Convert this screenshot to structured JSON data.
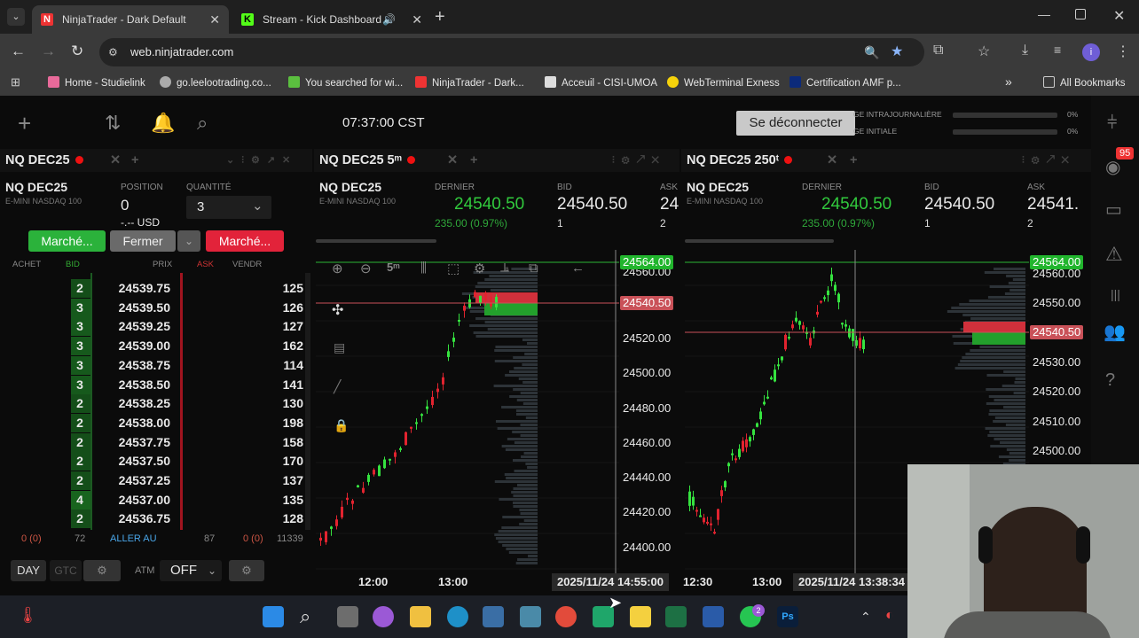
{
  "browser": {
    "tabs": [
      {
        "title": "NinjaTrader - Dark Default",
        "active": true
      },
      {
        "title": "Stream - Kick Dashboard",
        "active": false
      }
    ],
    "url": "web.ninjatrader.com",
    "bookmarks": [
      "Home - Studielink",
      "go.leelootrading.co...",
      "You searched for wi...",
      "NinjaTrader - Dark...",
      "Acceuil - CISI-UMOA",
      "WebTerminal Exness",
      "Certification AMF p..."
    ],
    "all_bookmarks": "All Bookmarks",
    "profile_initial": "i"
  },
  "app": {
    "clock": "07:37:00 CST",
    "logout_label": "Se déconnecter",
    "account": {
      "daily_label": "GE INTRAJOURNALIÈRE",
      "daily_pct": "0%",
      "initial_label": "GE INITIALE",
      "initial_pct": "0%"
    },
    "notification_count": "95"
  },
  "dom_panel": {
    "title": "NQ DEC25",
    "symbol": "NQ DEC25",
    "description": "E-MINI NASDAQ 100",
    "position_label": "POSITION",
    "position_value": "0",
    "pnl": "-.-- USD",
    "quantity_label": "QUANTITÉ",
    "quantity_value": "3",
    "buy_market": "Marché...",
    "close_label": "Fermer",
    "sell_market": "Marché...",
    "columns": [
      "ACHET",
      "BID",
      "PRIX",
      "ASK",
      "VENDR"
    ],
    "rows": [
      {
        "bid": "2",
        "price": "24539.75",
        "vol": "125"
      },
      {
        "bid": "3",
        "price": "24539.50",
        "vol": "126"
      },
      {
        "bid": "3",
        "price": "24539.25",
        "vol": "127"
      },
      {
        "bid": "3",
        "price": "24539.00",
        "vol": "162"
      },
      {
        "bid": "3",
        "price": "24538.75",
        "vol": "114"
      },
      {
        "bid": "3",
        "price": "24538.50",
        "vol": "141"
      },
      {
        "bid": "2",
        "price": "24538.25",
        "vol": "130"
      },
      {
        "bid": "2",
        "price": "24538.00",
        "vol": "198"
      },
      {
        "bid": "2",
        "price": "24537.75",
        "vol": "158"
      },
      {
        "bid": "2",
        "price": "24537.50",
        "vol": "170"
      },
      {
        "bid": "2",
        "price": "24537.25",
        "vol": "137"
      },
      {
        "bid": "4",
        "price": "24537.00",
        "vol": "135"
      },
      {
        "bid": "2",
        "price": "24536.75",
        "vol": "128"
      }
    ],
    "footer": {
      "left": "0 (0)",
      "bidtotal": "72",
      "goto": "ALLER AU",
      "asktotal": "87",
      "sellq": "0 (0)",
      "volq": "11339"
    },
    "tif_day": "DAY",
    "tif_gtc": "GTC",
    "atm_label": "ATM",
    "atm_value": "OFF"
  },
  "chart1": {
    "title": "NQ DEC25 5ᵐ",
    "symbol": "NQ DEC25",
    "description": "E-MINI NASDAQ 100",
    "last_label": "DERNIER",
    "last": "24540.50",
    "change": "235.00 (0.97%)",
    "bid_label": "BID",
    "bid": "24540.50",
    "bid_size": "1",
    "ask_label": "ASK",
    "ask": "24",
    "ask_size": "2",
    "interval": "5ᵐ",
    "yticks": [
      "24560.00",
      "24520.00",
      "24500.00",
      "24480.00",
      "24460.00",
      "24440.00",
      "24420.00",
      "24400.00"
    ],
    "high_tag": "24564.00",
    "last_tag": "24540.50",
    "xticks": [
      "12:00",
      "13:00"
    ],
    "cursor_time": "2025/11/24 14:55:00"
  },
  "chart2": {
    "title": "NQ DEC25 250ᵗ",
    "symbol": "NQ DEC25",
    "description": "E-MINI NASDAQ 100",
    "last_label": "DERNIER",
    "last": "24540.50",
    "change": "235.00 (0.97%)",
    "bid_label": "BID",
    "bid": "24540.50",
    "bid_size": "1",
    "ask_label": "ASK",
    "ask": "24541.",
    "ask_size": "2",
    "yticks": [
      "24560.00",
      "24550.00",
      "24530.00",
      "24520.00",
      "24510.00",
      "24500.00"
    ],
    "high_tag": "24564.00",
    "last_tag": "24540.50",
    "xticks": [
      "12:30",
      "13:00"
    ],
    "cursor_time": "2025/11/24 13:38:34"
  },
  "taskbar": {
    "whatsapp_badge": "2"
  }
}
